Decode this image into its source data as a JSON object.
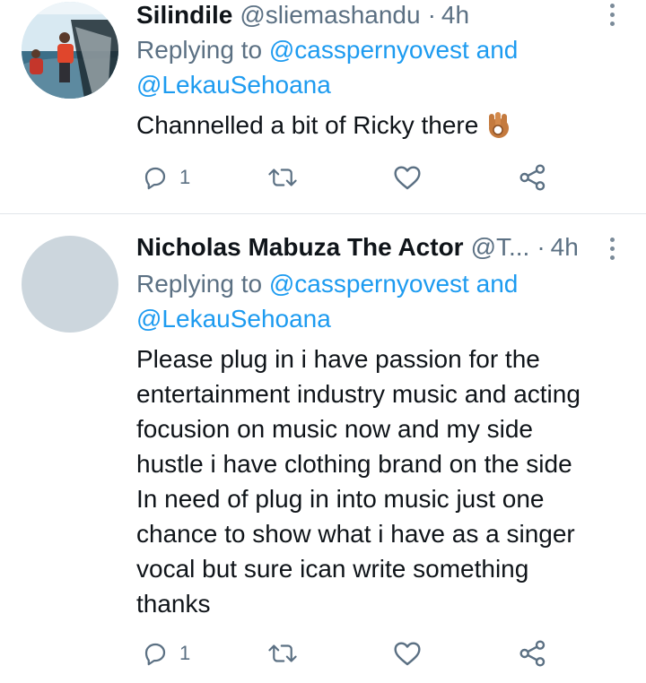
{
  "tweets": [
    {
      "display_name": "Silindile",
      "handle": "@sliemashandu",
      "separator": "·",
      "time": "4h",
      "replying_prefix": "Replying to",
      "reply_mention_1": "@casspernyovest",
      "reply_and": "and",
      "reply_mention_2": "@LekauSehoana",
      "text": "Channelled a bit of Ricky there",
      "emoji": "ok-hand-emoji",
      "actions": {
        "reply_count": "1",
        "retweet_count": "",
        "like_count": ""
      },
      "icons": {
        "reply": "reply-icon",
        "retweet": "retweet-icon",
        "like": "heart-icon",
        "share": "share-icon",
        "more": "more-vertical-icon"
      }
    },
    {
      "display_name": "Nicholas Mabuza The Actor",
      "handle": "@T...",
      "separator": "·",
      "time": "4h",
      "replying_prefix": "Replying to",
      "reply_mention_1": "@casspernyovest",
      "reply_and": "and",
      "reply_mention_2": "@LekauSehoana",
      "text_lines": [
        "Please plug in i have passion for the",
        "entertainment industry music and acting",
        "focusion on music now and my side",
        "hustle i have clothing brand on the side",
        "In need of plug in into music just one",
        "chance to show what i have as a singer",
        "vocal but sure ican write something",
        "thanks"
      ],
      "actions": {
        "reply_count": "1",
        "retweet_count": "",
        "like_count": ""
      },
      "icons": {
        "reply": "reply-icon",
        "retweet": "retweet-icon",
        "like": "heart-icon",
        "share": "share-icon",
        "more": "more-vertical-icon"
      }
    }
  ],
  "colors": {
    "link": "#1d9bf0",
    "secondary_text": "#5b7083",
    "primary_text": "#0f1419",
    "divider": "#e1e5ea",
    "blank_avatar": "#ccd6dd"
  }
}
